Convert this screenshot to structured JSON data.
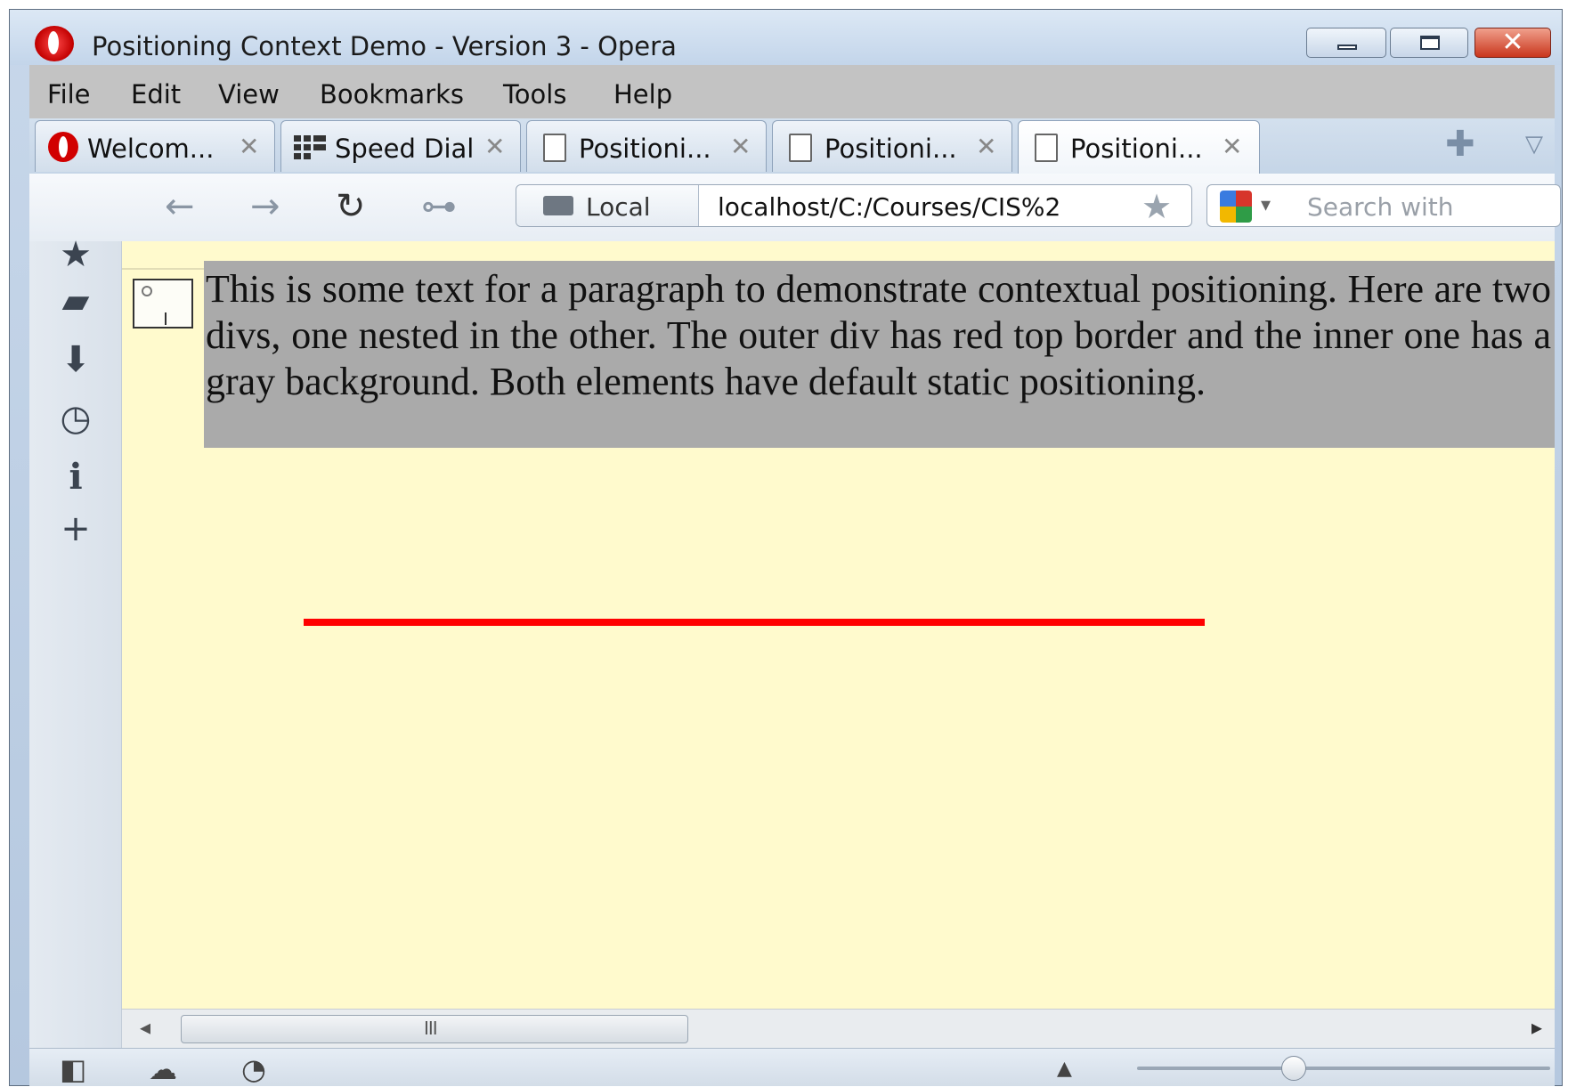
{
  "window": {
    "title": "Positioning Context Demo - Version 3 - Opera",
    "close_glyph": "✕"
  },
  "menu": {
    "items": [
      "File",
      "Edit",
      "View",
      "Bookmarks",
      "Tools",
      "Help"
    ]
  },
  "tabs": [
    {
      "label": "Welcom...",
      "icon": "opera-icon",
      "active": false
    },
    {
      "label": "Speed Dial",
      "icon": "speed-dial-icon",
      "active": false
    },
    {
      "label": "Positioni...",
      "icon": "page-icon",
      "active": false
    },
    {
      "label": "Positioni...",
      "icon": "page-icon",
      "active": false
    },
    {
      "label": "Positioni...",
      "icon": "page-icon",
      "active": true
    }
  ],
  "tab_close_glyph": "✕",
  "toolbar": {
    "back_glyph": "←",
    "forward_glyph": "→",
    "reload_glyph": "↻",
    "key_glyph": "⊶",
    "new_tab_glyph": "✚",
    "tab_menu_glyph": "▽"
  },
  "address": {
    "badge": "Local",
    "url": "localhost/C:/Courses/CIS%2",
    "star_glyph": "★"
  },
  "search": {
    "placeholder": "Search with",
    "arrow_glyph": "▾"
  },
  "sidebar": {
    "icons": [
      {
        "name": "bookmarks-star-icon",
        "glyph": "★"
      },
      {
        "name": "notes-icon",
        "glyph": "▰"
      },
      {
        "name": "downloads-icon",
        "glyph": "⬇"
      },
      {
        "name": "history-clock-icon",
        "glyph": "◷"
      },
      {
        "name": "info-icon",
        "glyph": "ℹ"
      },
      {
        "name": "add-panel-icon",
        "glyph": "+"
      }
    ]
  },
  "page": {
    "paragraph": "This is some text for a paragraph to demonstrate contextual positioning. Here are two divs, one nested in the other. The outer div has red top border and the inner one has a gray background. Both elements have default static positioning.",
    "background_color": "#fffacd",
    "inner_div_color": "#aaaaaa",
    "outer_border_color": "#ff0000"
  },
  "scrollbar": {
    "left_glyph": "◂",
    "right_glyph": "▸",
    "grip": "III"
  },
  "statusbar": {
    "panel_toggle_glyph": "◧",
    "cloud_glyph": "☁",
    "speed_glyph": "◔",
    "up_glyph": "▲",
    "zoom_level": 0.38
  }
}
